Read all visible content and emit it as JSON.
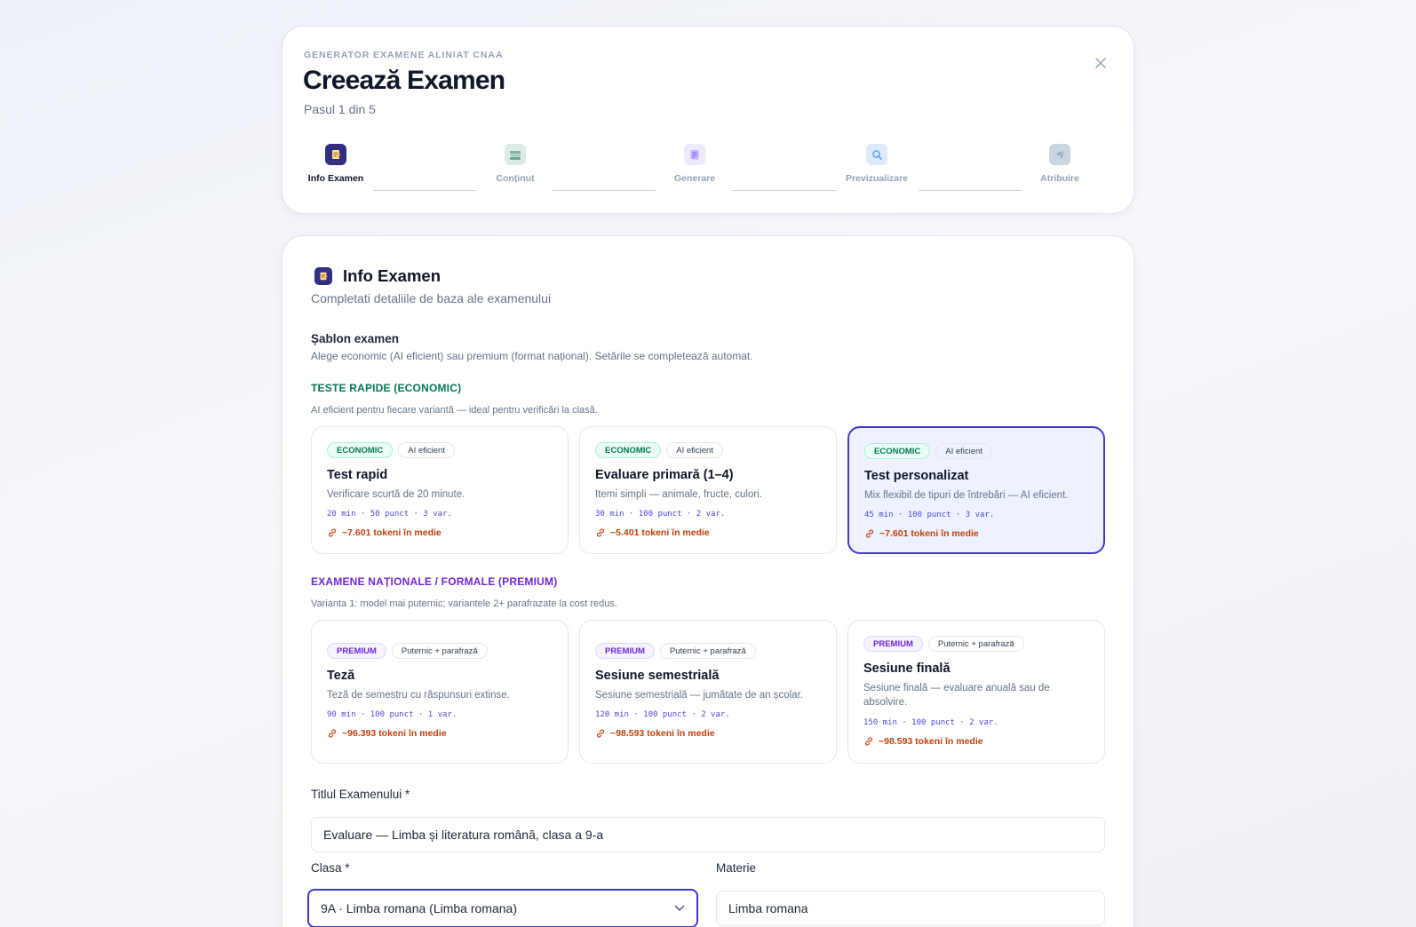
{
  "header": {
    "eyebrow": "GENERATOR EXAMENE ALINIAT CNAA",
    "title": "Creează Examen",
    "step_counter": "Pasul 1 din 5"
  },
  "stepper": {
    "steps": [
      {
        "label": "Info Examen",
        "icon": "document-pencil-icon",
        "active": true,
        "color": "#312e81"
      },
      {
        "label": "Conținut",
        "icon": "books-icon",
        "active": false,
        "color": "#9bc5b8"
      },
      {
        "label": "Generare",
        "icon": "notepad-icon",
        "active": false,
        "color": "#c4b5fd"
      },
      {
        "label": "Previzualizare",
        "icon": "magnifier-icon",
        "active": false,
        "color": "#93c5fd"
      },
      {
        "label": "Atribuire",
        "icon": "send-icon",
        "active": false,
        "color": "#94a3b8"
      }
    ]
  },
  "main": {
    "section_title": "Info Examen",
    "section_subtitle": "Completati detaliile de baza ale examenului",
    "template_label": "Șablon examen",
    "template_help": "Alege economic (AI eficient) sau premium (format național). Setările se completează automat.",
    "economic_group": {
      "title": "TESTE RAPIDE (ECONOMIC)",
      "description": "AI eficient pentru fiecare variantă — ideal pentru verificări la clasă.",
      "cards": [
        {
          "badge": "ECONOMIC",
          "tag": "AI eficient",
          "title": "Test rapid",
          "description": "Verificare scurtă de 20 minute.",
          "meta": "20 min · 50 punct · 3 var.",
          "tokens": "~7.601 tokeni în medie",
          "selected": false
        },
        {
          "badge": "ECONOMIC",
          "tag": "AI eficient",
          "title": "Evaluare primară (1–4)",
          "description": "Itemi simpli — animale, fructe, culori.",
          "meta": "30 min · 100 punct · 2 var.",
          "tokens": "~5.401 tokeni în medie",
          "selected": false
        },
        {
          "badge": "ECONOMIC",
          "tag": "AI eficient",
          "title": "Test personalizat",
          "description": "Mix flexibil de tipuri de întrebări — AI eficient.",
          "meta": "45 min · 100 punct · 3 var.",
          "tokens": "~7.601 tokeni în medie",
          "selected": true
        }
      ]
    },
    "premium_group": {
      "title": "EXAMENE NAȚIONALE / FORMALE (PREMIUM)",
      "description": "Varianta 1: model mai puternic; variantele 2+ parafrazate la cost redus.",
      "cards": [
        {
          "badge": "PREMIUM",
          "tag": "Puternic + parafrază",
          "title": "Teză",
          "description": "Teză de semestru cu răspunsuri extinse.",
          "meta": "90 min · 100 punct · 1 var.",
          "tokens": "~96.393 tokeni în medie"
        },
        {
          "badge": "PREMIUM",
          "tag": "Puternic + parafrază",
          "title": "Sesiune semestrială",
          "description": "Sesiune semestrială — jumătate de an școlar.",
          "meta": "120 min · 100 punct · 2 var.",
          "tokens": "~98.593 tokeni în medie"
        },
        {
          "badge": "PREMIUM",
          "tag": "Puternic + parafrază",
          "title": "Sesiune finală",
          "description": "Sesiune finală — evaluare anuală sau de absolvire.",
          "meta": "150 min · 100 punct · 2 var.",
          "tokens": "~98.593 tokeni în medie"
        }
      ]
    },
    "form": {
      "title_label": "Titlul Examenului *",
      "title_value": "Evaluare — Limba și literatura română, clasa a 9-a",
      "class_label": "Clasa *",
      "class_value": "9A · Limba romana (Limba romana)",
      "subject_label": "Materie",
      "subject_value": "Limba romana"
    }
  },
  "colors": {
    "accent": "#4338ca",
    "economic": "#047857",
    "premium": "#6d28d9",
    "tokens": "#c2410c"
  }
}
